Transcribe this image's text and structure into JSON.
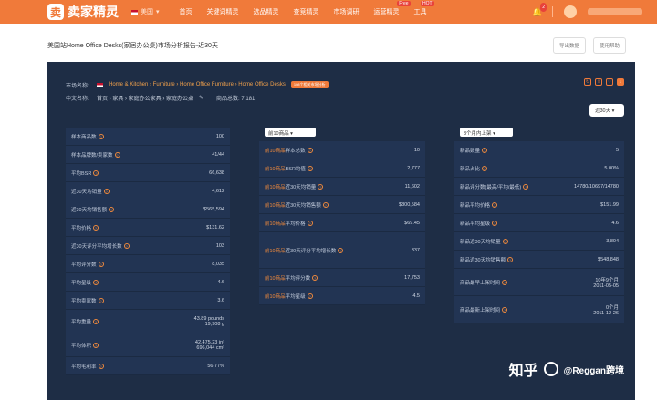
{
  "topbar": {
    "logo_text": "卖家精灵",
    "site_label": "美国",
    "nav": [
      "首页",
      "关键词精灵",
      "选品精灵",
      "查竞精灵",
      "市场调研",
      "运营精灵",
      "工具"
    ],
    "badge_free": "Free",
    "badge_hot": "HOT",
    "bell_count": "2"
  },
  "title": {
    "text": "美国站Home Office Desks(家居办公桌)市场分析报告-近30天",
    "btn_export": "导出数据",
    "btn_help": "使用帮助"
  },
  "meta": {
    "market_label": "市场名称:",
    "market_path": "Home & Kitchen › Furniture › Home Office Furniture › Home Office Desks",
    "market_badge": "108个相关市场分析",
    "cn_label": "中文名称:",
    "cn_path": "首页 › 家具 › 家庭办公家具 › 家庭办公桌",
    "edit_icon": "edit-icon",
    "product_count": "商品总数: 7,181"
  },
  "range_select": "近30天",
  "col_a": {
    "rows": [
      {
        "label": "样本商品数",
        "value": "100",
        "h": 20
      },
      {
        "label": "样本品牌数/卖家数",
        "value": "41/44",
        "h": 20
      },
      {
        "label": "平均BSR",
        "value": "66,638",
        "h": 20
      },
      {
        "label": "近30天均销量",
        "value": "4,612",
        "h": 20
      },
      {
        "label": "近30天均销售额",
        "value": "$565,594",
        "h": 20
      },
      {
        "label": "平均价格",
        "value": "$131.62",
        "h": 20
      },
      {
        "label": "近30天评分平均增长数",
        "value": "103",
        "h": 20
      },
      {
        "label": "平均评分数",
        "value": "8,035",
        "h": 20
      },
      {
        "label": "平均星级",
        "value": "4.6",
        "h": 20
      },
      {
        "label": "平均卖家数",
        "value": "3.6",
        "h": 20
      },
      {
        "label": "平均重量",
        "value": "43.89 pounds\n19,908 g",
        "h": 26
      },
      {
        "label": "平均体积",
        "value": "42,475.23 in³\n696,044 cm³",
        "h": 26
      },
      {
        "label": "平均毛利率",
        "value": "56.77%",
        "h": 20
      }
    ]
  },
  "col_b": {
    "select": "前10商品",
    "rows": [
      {
        "label_hl": "前10商品",
        "label": "样本总数",
        "value": "10",
        "h": 20
      },
      {
        "label_hl": "前10商品",
        "label": "BSR均值",
        "value": "2,777",
        "h": 20
      },
      {
        "label_hl": "前10商品",
        "label": "近30天均销量",
        "value": "11,602",
        "h": 20
      },
      {
        "label_hl": "前10商品",
        "label": "近30天均销售额",
        "value": "$800,584",
        "h": 20
      },
      {
        "label_hl": "前10商品",
        "label": "平均价格",
        "value": "$69.45",
        "h": 20
      },
      {
        "label_hl": "前10商品",
        "label": "近30天评分平均增长数",
        "value": "337",
        "h": 40
      },
      {
        "label_hl": "前10商品",
        "label": "平均评分数",
        "value": "17,753",
        "h": 20
      },
      {
        "label_hl": "前10商品",
        "label": "平均星级",
        "value": "4.5",
        "h": 20
      }
    ]
  },
  "col_c": {
    "select": "3个月内上架",
    "rows": [
      {
        "label": "新品数量",
        "value": "5",
        "h": 20
      },
      {
        "label": "新品占比",
        "value": "5.00%",
        "h": 20
      },
      {
        "label": "新品评分数(最高/平均/最低)",
        "value": "14780/10697/14780",
        "h": 20
      },
      {
        "label": "新品平均价格",
        "value": "$151.99",
        "h": 20
      },
      {
        "label": "新品平均星级",
        "value": "4.6",
        "h": 20
      },
      {
        "label": "新品近30天均销量",
        "value": "3,804",
        "h": 20
      },
      {
        "label": "新品近30天均销售额",
        "value": "$548,848",
        "h": 20
      },
      {
        "label": "商品最早上架时间",
        "value": "10年9个月\n2011-05-05",
        "h": 30
      },
      {
        "label": "商品最新上架时间",
        "value": "0个月\n2011-12-26",
        "h": 30
      }
    ]
  },
  "watermark": {
    "zhihu": "知乎",
    "author": "@Reggan跨境"
  },
  "colors": {
    "brand": "#f07a3a",
    "panel": "#1e2d45",
    "row": "#223453"
  }
}
